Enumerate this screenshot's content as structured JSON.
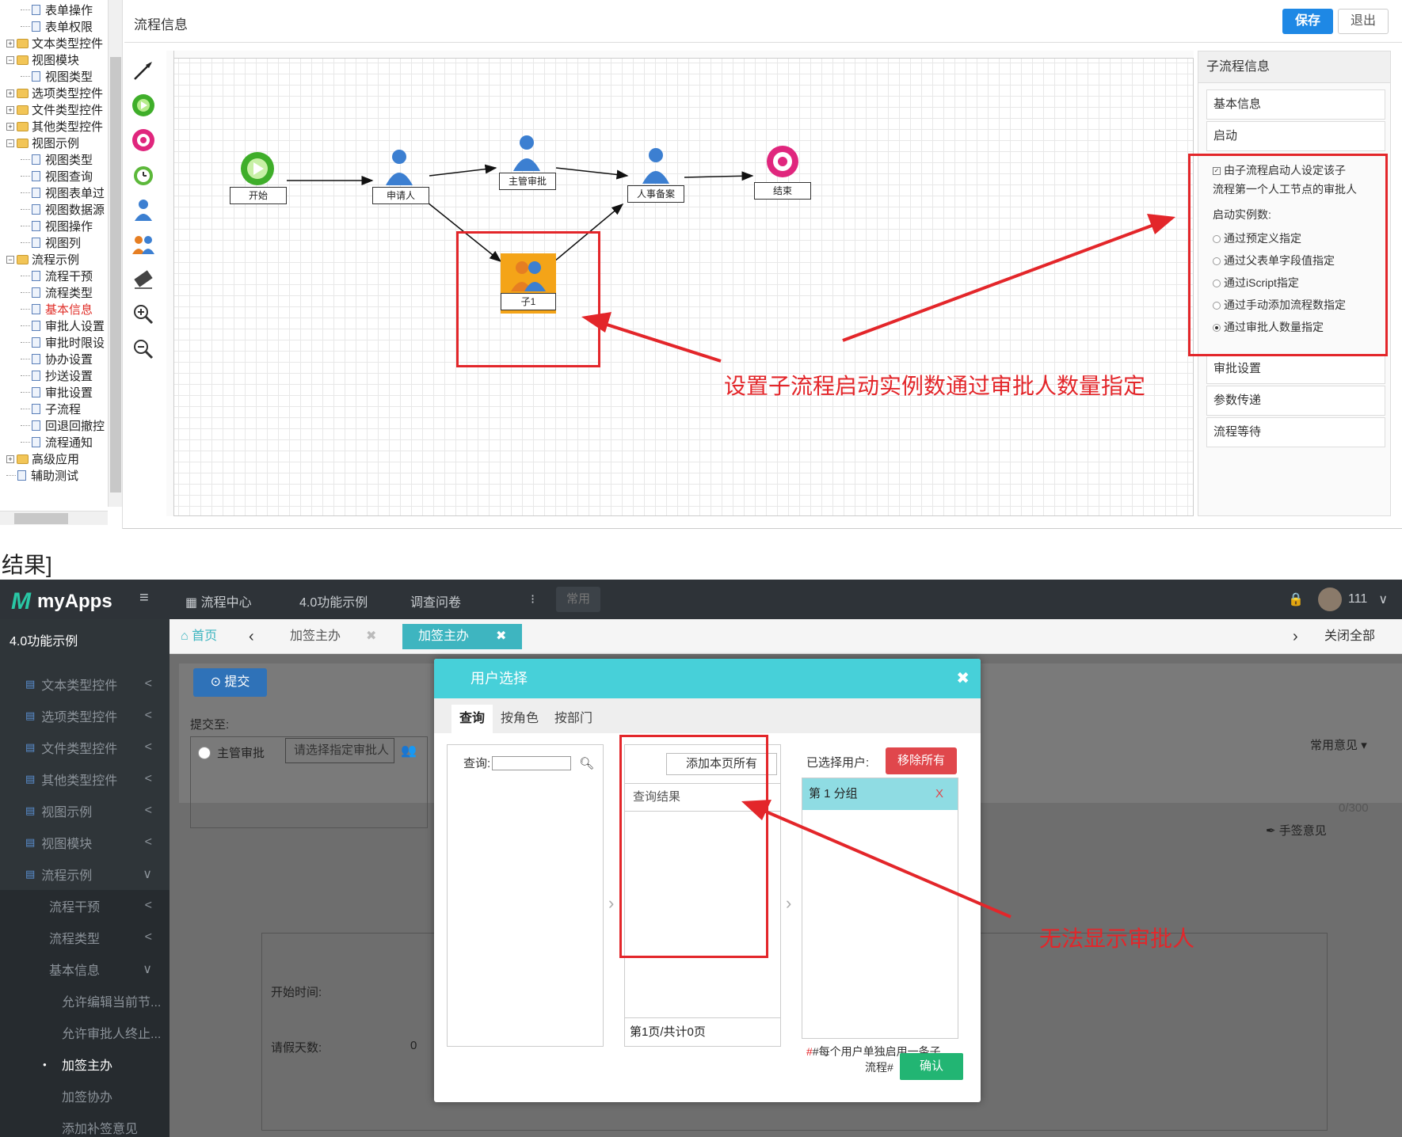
{
  "top": {
    "tree": [
      {
        "label": "表单操作",
        "type": "page",
        "level": 2
      },
      {
        "label": "表单权限",
        "type": "page",
        "level": 2
      },
      {
        "label": "文本类型控件",
        "type": "folder",
        "level": 1
      },
      {
        "label": "视图模块",
        "type": "folder",
        "level": 1,
        "open": true
      },
      {
        "label": "视图类型",
        "type": "page",
        "level": 2
      },
      {
        "label": "选项类型控件",
        "type": "folder",
        "level": 1
      },
      {
        "label": "文件类型控件",
        "type": "folder",
        "level": 1
      },
      {
        "label": "其他类型控件",
        "type": "folder",
        "level": 1
      },
      {
        "label": "视图示例",
        "type": "folder",
        "level": 1,
        "open": true
      },
      {
        "label": "视图类型",
        "type": "page",
        "level": 2
      },
      {
        "label": "视图查询",
        "type": "page",
        "level": 2
      },
      {
        "label": "视图表单过",
        "type": "page",
        "level": 2
      },
      {
        "label": "视图数据源",
        "type": "page",
        "level": 2
      },
      {
        "label": "视图操作",
        "type": "page",
        "level": 2
      },
      {
        "label": "视图列",
        "type": "page",
        "level": 2
      },
      {
        "label": "流程示例",
        "type": "folder",
        "level": 1,
        "open": true
      },
      {
        "label": "流程干预",
        "type": "page",
        "level": 2
      },
      {
        "label": "流程类型",
        "type": "page",
        "level": 2
      },
      {
        "label": "基本信息",
        "type": "page",
        "level": 2,
        "selected": true
      },
      {
        "label": "审批人设置",
        "type": "page",
        "level": 2
      },
      {
        "label": "审批时限设",
        "type": "page",
        "level": 2
      },
      {
        "label": "协办设置",
        "type": "page",
        "level": 2
      },
      {
        "label": "抄送设置",
        "type": "page",
        "level": 2
      },
      {
        "label": "审批设置",
        "type": "page",
        "level": 2
      },
      {
        "label": "子流程",
        "type": "page",
        "level": 2
      },
      {
        "label": "回退回撤控",
        "type": "page",
        "level": 2
      },
      {
        "label": "流程通知",
        "type": "page",
        "level": 2
      },
      {
        "label": "高级应用",
        "type": "folder",
        "level": 1
      },
      {
        "label": "辅助测试",
        "type": "page",
        "level": 1
      }
    ],
    "header_title": "流程信息",
    "save_label": "保存",
    "exit_label": "退出",
    "nodes": {
      "start": "开始",
      "applicant": "申请人",
      "manager": "主管审批",
      "hr": "人事备案",
      "end": "结束",
      "sub": "子1"
    },
    "panel": {
      "title": "子流程信息",
      "basic": "基本信息",
      "start": "启动",
      "checkbox": "由子流程启动人设定该子流程第一个人工节点的审批人",
      "checkbox_line1": "由子流程启动人设定该子",
      "checkbox_line2": "流程第一个人工节点的审批人",
      "instances_label": "启动实例数:",
      "options": [
        {
          "label": "通过预定义指定",
          "checked": false
        },
        {
          "label": "通过父表单字段值指定",
          "checked": false
        },
        {
          "label": "通过iScript指定",
          "checked": false
        },
        {
          "label": "通过手动添加流程数指定",
          "checked": false
        },
        {
          "label": "通过审批人数量指定",
          "checked": true
        }
      ],
      "approve": "审批设置",
      "params": "参数传递",
      "wait": "流程等待"
    },
    "annotation": "设置子流程启动实例数通过审批人数量指定"
  },
  "separator": "结果]",
  "bottom": {
    "brand": "myApps",
    "nav": [
      "流程中心",
      "4.0功能示例",
      "调查问卷"
    ],
    "nav_common": "常用",
    "user": "111",
    "sidebar_title": "4.0功能示例",
    "sidebar": [
      {
        "label": "文本类型控件",
        "arrow": "<"
      },
      {
        "label": "选项类型控件",
        "arrow": "<"
      },
      {
        "label": "文件类型控件",
        "arrow": "<"
      },
      {
        "label": "其他类型控件",
        "arrow": "<"
      },
      {
        "label": "视图示例",
        "arrow": "<"
      },
      {
        "label": "视图模块",
        "arrow": "<"
      },
      {
        "label": "流程示例",
        "arrow": "∨"
      }
    ],
    "sidebar_sub": [
      {
        "label": "流程干预",
        "arrow": "<"
      },
      {
        "label": "流程类型",
        "arrow": "<"
      },
      {
        "label": "基本信息",
        "arrow": "∨"
      }
    ],
    "sidebar_sub2": [
      "允许编辑当前节...",
      "允许审批人终止...",
      "加签主办",
      "加签协办",
      "添加补签意见"
    ],
    "sidebar_selected": "加签主办",
    "tabs": {
      "home": "首页",
      "tab1": "加签主办",
      "tab2": "加签主办",
      "close_all": "关闭全部"
    },
    "submit": "提交",
    "submit_to": "提交至:",
    "manager_label": "主管审批",
    "choose_placeholder": "请选择指定审批人",
    "common_opinion": "常用意见",
    "counter": "0/300",
    "sign": "手签意见",
    "start_time": "开始时间:",
    "leave_days": "请假天数:",
    "leave_value": "0",
    "modal": {
      "title": "用户选择",
      "tabs": [
        "查询",
        "按角色",
        "按部门"
      ],
      "query_label": "查询:",
      "add_all": "添加本页所有",
      "results_label": "查询结果",
      "pager": "第1页/共计0页",
      "selected_label": "已选择用户:",
      "remove_all": "移除所有",
      "group": "第 1 分组",
      "group_remove": "X",
      "note": "#每个用户单独启用一条子流程#",
      "note_line1": "#每个用户单独启用一条子",
      "note_line2": "流程#",
      "confirm": "确认"
    },
    "annotation": "无法显示审批人"
  }
}
